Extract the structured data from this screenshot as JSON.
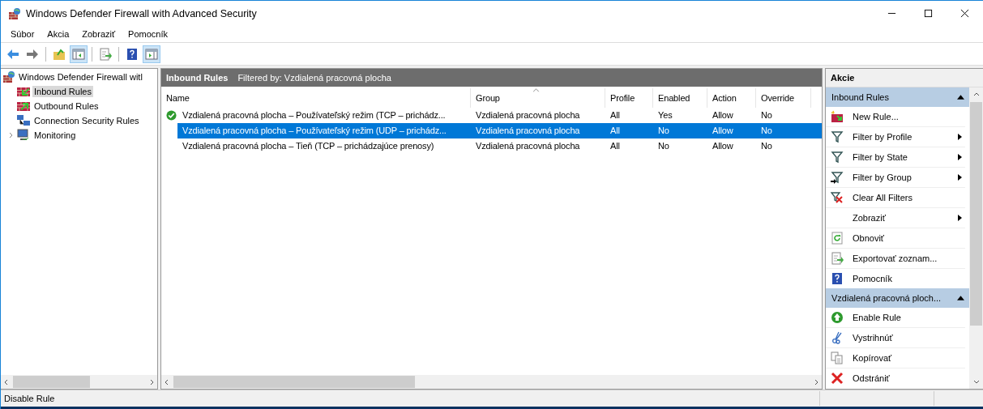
{
  "window": {
    "title": "Windows Defender Firewall with Advanced Security"
  },
  "menu": [
    "Súbor",
    "Akcia",
    "Zobraziť",
    "Pomocník"
  ],
  "toolbar": [
    {
      "kind": "back",
      "pressed": false
    },
    {
      "kind": "forward",
      "pressed": false
    },
    {
      "kind": "up",
      "pressed": false
    },
    {
      "kind": "tree",
      "pressed": true
    },
    {
      "kind": "export",
      "pressed": false
    },
    {
      "kind": "help",
      "pressed": false
    },
    {
      "kind": "pane",
      "pressed": true
    }
  ],
  "tree": {
    "label": "Windows Defender Firewall witl",
    "children": [
      {
        "label": "Inbound Rules",
        "kind": "inbound",
        "selected": true
      },
      {
        "label": "Outbound Rules",
        "kind": "outbound",
        "selected": false
      },
      {
        "label": "Connection Security Rules",
        "kind": "connection",
        "selected": false
      },
      {
        "label": "Monitoring",
        "kind": "monitor",
        "selected": false,
        "expandable": true
      }
    ]
  },
  "rules_panel": {
    "title": "Inbound Rules",
    "filter": "Filtered by: Vzdialená pracovná plocha"
  },
  "table": {
    "columns": [
      {
        "label": "Name",
        "sorted": false
      },
      {
        "label": "Group",
        "sorted": true
      },
      {
        "label": "Profile",
        "sorted": false
      },
      {
        "label": "Enabled",
        "sorted": false
      },
      {
        "label": "Action",
        "sorted": false
      },
      {
        "label": "Override",
        "sorted": false
      }
    ],
    "rows": [
      {
        "name": "Vzdialená pracovná plocha – Používateľský režim (TCP – prichádz...",
        "group": "Vzdialená pracovná plocha",
        "profile": "All",
        "enabled": "Yes",
        "action": "Allow",
        "override": "No",
        "active": true,
        "selected": false
      },
      {
        "name": "Vzdialená pracovná plocha – Používateľský režim (UDP – prichádz...",
        "group": "Vzdialená pracovná plocha",
        "profile": "All",
        "enabled": "No",
        "action": "Allow",
        "override": "No",
        "active": false,
        "selected": true
      },
      {
        "name": "Vzdialená pracovná plocha – Tieň (TCP – prichádzajúce prenosy)",
        "group": "Vzdialená pracovná plocha",
        "profile": "All",
        "enabled": "No",
        "action": "Allow",
        "override": "No",
        "active": false,
        "selected": false
      }
    ]
  },
  "actions": {
    "title": "Akcie",
    "sections": [
      {
        "title": "Inbound Rules",
        "items": [
          {
            "label": "New Rule...",
            "kind": "new",
            "submenu": false
          },
          {
            "label": "Filter by Profile",
            "kind": "filter",
            "submenu": true
          },
          {
            "label": "Filter by State",
            "kind": "filter",
            "submenu": true
          },
          {
            "label": "Filter by Group",
            "kind": "filter-group",
            "submenu": true
          },
          {
            "label": "Clear All Filters",
            "kind": "clear",
            "submenu": false
          },
          {
            "label": "Zobraziť",
            "kind": "none",
            "submenu": true
          },
          {
            "label": "Obnoviť",
            "kind": "refresh",
            "submenu": false
          },
          {
            "label": "Exportovať zoznam...",
            "kind": "export",
            "submenu": false
          },
          {
            "label": "Pomocník",
            "kind": "help",
            "submenu": false
          }
        ]
      },
      {
        "title": "Vzdialená pracovná ploch...",
        "items": [
          {
            "label": "Enable Rule",
            "kind": "enable",
            "submenu": false
          },
          {
            "label": "Vystrihnúť",
            "kind": "cut",
            "submenu": false
          },
          {
            "label": "Kopírovať",
            "kind": "copy",
            "submenu": false
          },
          {
            "label": "Odstrániť",
            "kind": "delete",
            "submenu": false
          }
        ]
      }
    ]
  },
  "status_bar": {
    "text": "Disable Rule"
  }
}
